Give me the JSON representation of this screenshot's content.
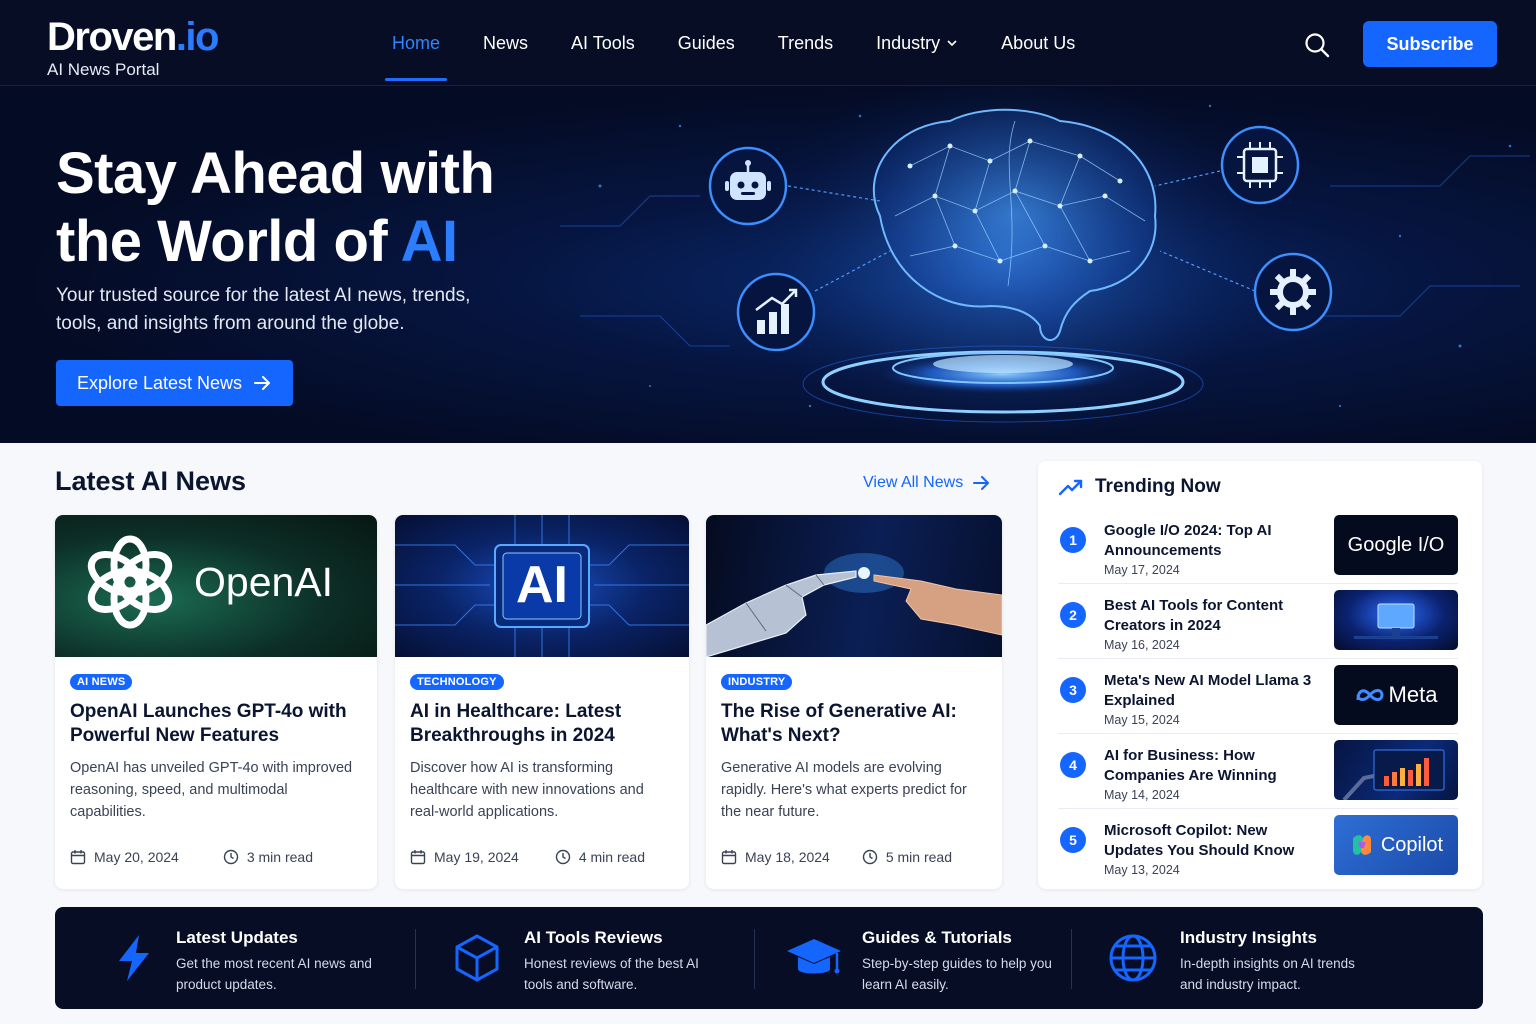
{
  "brand": {
    "name": "Droven",
    "suffix": ".io",
    "tagline": "AI News Portal"
  },
  "nav": {
    "items": [
      {
        "label": "Home",
        "active": true
      },
      {
        "label": "News"
      },
      {
        "label": "AI Tools"
      },
      {
        "label": "Guides"
      },
      {
        "label": "Trends"
      },
      {
        "label": "Industry",
        "has_dropdown": true
      },
      {
        "label": "About Us"
      }
    ],
    "search_icon": "search-icon",
    "subscribe_label": "Subscribe"
  },
  "hero": {
    "title_line1": "Stay Ahead with",
    "title_line2_prefix": "the World of ",
    "title_line2_accent": "AI",
    "subtitle": "Your trusted source for the latest AI news, trends, tools, and insights from around the globe.",
    "cta_label": "Explore Latest News",
    "icons": [
      "robot-icon",
      "chip-icon",
      "chart-growth-icon",
      "gear-icon",
      "brain-icon"
    ]
  },
  "latest": {
    "title": "Latest AI News",
    "view_all": "View All News",
    "cards": [
      {
        "tag": "AI NEWS",
        "title": "OpenAI Launches GPT-4o with Powerful New Features",
        "desc": "OpenAI has unveiled GPT-4o with improved reasoning, speed, and multimodal capabilities.",
        "date": "May 20, 2024",
        "read": "3 min read",
        "image_text": "OpenAI"
      },
      {
        "tag": "TECHNOLOGY",
        "title": "AI in Healthcare: Latest Breakthroughs in 2024",
        "desc": "Discover how AI is transforming healthcare with new innovations and real-world applications.",
        "date": "May 19, 2024",
        "read": "4 min read",
        "image_text": "AI"
      },
      {
        "tag": "INDUSTRY",
        "title": "The Rise of Generative AI: What's Next?",
        "desc": "Generative AI models are evolving rapidly. Here's what experts predict for the near future.",
        "date": "May 18, 2024",
        "read": "5 min read",
        "image_text": ""
      }
    ]
  },
  "trending": {
    "title": "Trending Now",
    "items": [
      {
        "num": "1",
        "title": "Google I/O 2024: Top AI Announcements",
        "date": "May 17, 2024",
        "thumb": "Google I/O"
      },
      {
        "num": "2",
        "title": "Best AI Tools for Content Creators in 2024",
        "date": "May 16, 2024",
        "thumb": ""
      },
      {
        "num": "3",
        "title": "Meta's New AI Model Llama 3 Explained",
        "date": "May 15, 2024",
        "thumb": "Meta"
      },
      {
        "num": "4",
        "title": "AI for Business: How Companies Are Winning",
        "date": "May 14, 2024",
        "thumb": ""
      },
      {
        "num": "5",
        "title": "Microsoft Copilot: New Updates You Should Know",
        "date": "May 13, 2024",
        "thumb": "Copilot"
      }
    ]
  },
  "features": [
    {
      "icon": "lightning-icon",
      "title": "Latest Updates",
      "desc": "Get the most recent AI news and product updates."
    },
    {
      "icon": "cube-icon",
      "title": "AI Tools Reviews",
      "desc": "Honest reviews of the best AI tools and software."
    },
    {
      "icon": "graduation-cap-icon",
      "title": "Guides & Tutorials",
      "desc": "Step-by-step guides to help you learn AI easily."
    },
    {
      "icon": "globe-icon",
      "title": "Industry Insights",
      "desc": "In-depth insights on AI trends and industry impact."
    }
  ],
  "colors": {
    "accent": "#1565ff",
    "nav_bg": "#060d24",
    "page_bg": "#f7f8fb"
  }
}
